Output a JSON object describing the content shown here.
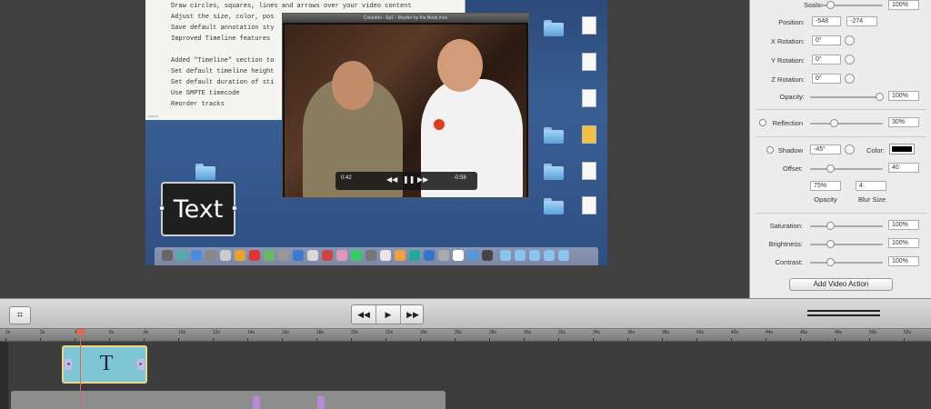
{
  "canvas": {
    "doc_lines": [
      "Draw circles, squares, lines and arrows over your video content",
      "Adjust the size, color, pos",
      "Save default annotation sty",
      "Improved Timeline features",
      "",
      "Added \"Timeline\" section to",
      "Set default timeline height",
      "Set default duration of sti",
      "Use SMPTE timecode",
      "Reorder tracks"
    ],
    "video_window_title": "Columbo - Ep1 - Murder by the Book.mov",
    "callout_text": "Text",
    "player_time_left": "0:42",
    "player_time_right": "-0:58"
  },
  "inspector": {
    "scale_label": "Scale:",
    "scale_value": "100%",
    "position_label": "Position:",
    "position_x": "-548",
    "position_y": "-274",
    "xrot_label": "X Rotation:",
    "xrot_value": "0°",
    "yrot_label": "Y Rotation:",
    "yrot_value": "0°",
    "zrot_label": "Z Rotation:",
    "zrot_value": "0°",
    "opacity_label": "Opacity:",
    "opacity_value": "100%",
    "reflection_label": "Reflection",
    "reflection_value": "30%",
    "shadow_label": "Shadow",
    "shadow_angle": "-45°",
    "color_label": "Color:",
    "offset_label": "Offset:",
    "offset_value": "40",
    "shadow_opacity_value": "75%",
    "blur_value": "4",
    "shadow_opacity_caption": "Opacity",
    "blur_caption": "Blur Size",
    "saturation_label": "Saturation:",
    "saturation_value": "100%",
    "brightness_label": "Brightness:",
    "brightness_value": "100%",
    "contrast_label": "Contrast:",
    "contrast_value": "100%",
    "add_action_label": "Add Video Action"
  },
  "toolbar": {
    "crop_icon": "⌗",
    "rewind": "◀◀",
    "play": "▶",
    "forward": "▶▶"
  },
  "timeline": {
    "ruler_labels": [
      "0s",
      "2s",
      "4s",
      "6s",
      "8s",
      "10s",
      "12s",
      "14s",
      "16s",
      "18s",
      "20s",
      "22s",
      "24s",
      "26s",
      "28s",
      "30s",
      "32s",
      "34s",
      "36s",
      "38s",
      "40s",
      "42s",
      "44s",
      "46s",
      "48s",
      "50s",
      "52s"
    ],
    "clip_icon": "T",
    "clip_edge_left": "◂",
    "clip_edge_right": "▸"
  }
}
